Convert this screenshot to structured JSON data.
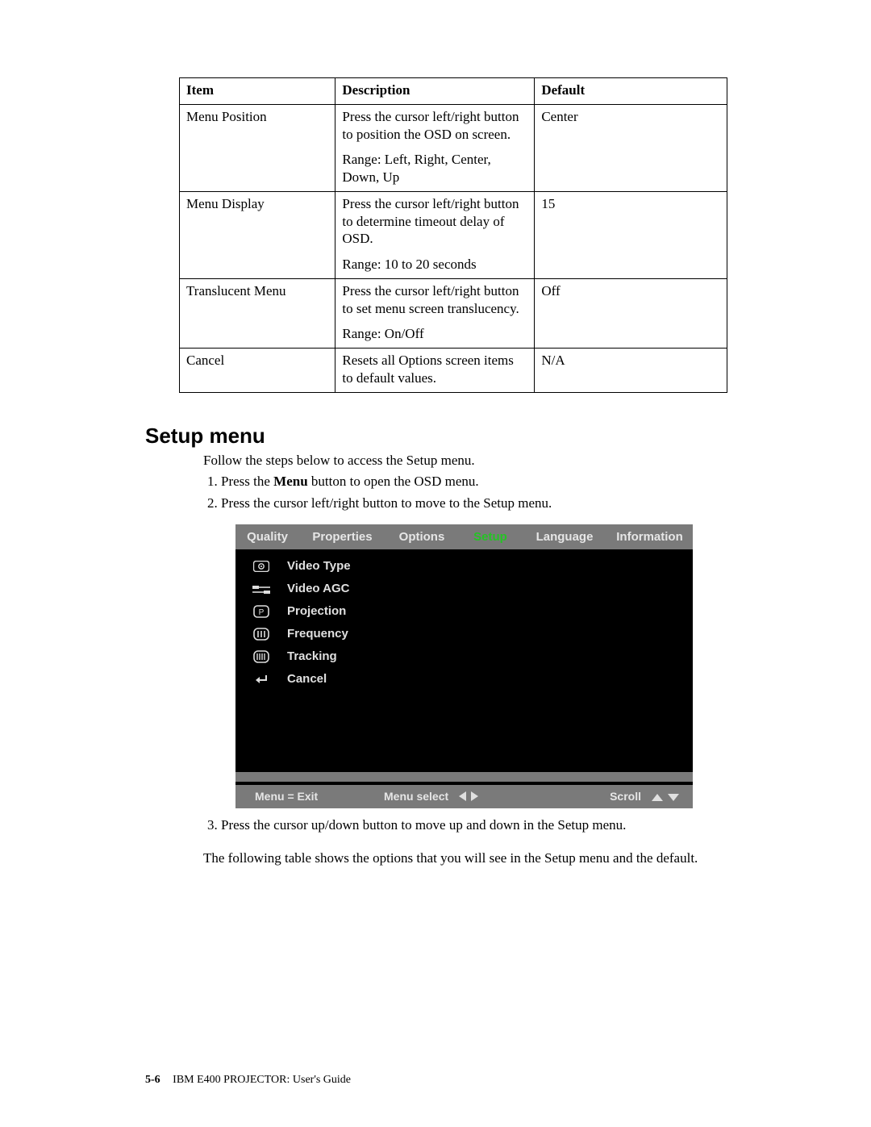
{
  "table": {
    "headers": {
      "c1": "Item",
      "c2": "Description",
      "c3": "Default"
    },
    "rows": [
      {
        "item": "Menu Position",
        "desc1": "Press the cursor left/right button to position the OSD on screen.",
        "desc2": "Range: Left, Right, Center, Down, Up",
        "default": "Center"
      },
      {
        "item": "Menu Display",
        "desc1": "Press the cursor left/right button to determine timeout delay of OSD.",
        "desc2": "Range: 10 to 20 seconds",
        "default": "15"
      },
      {
        "item": "Translucent Menu",
        "desc1": "Press the cursor left/right button to set menu screen translucency.",
        "desc2": "Range: On/Off",
        "default": "Off"
      },
      {
        "item": "Cancel",
        "desc1": "Resets all Options screen items to default values.",
        "desc2": "",
        "default": "N/A"
      }
    ]
  },
  "section_heading": "Setup menu",
  "intro_text": "Follow the steps below to access the Setup menu.",
  "steps": {
    "s1a": "Press the ",
    "s1b": "Menu",
    "s1c": " button to open the OSD menu.",
    "s2": "Press the cursor left/right button to move to the Setup menu."
  },
  "osd": {
    "tabs": [
      "Quality",
      "Properties",
      "Options",
      "Setup",
      "Language",
      "Information"
    ],
    "active_tab": "Setup",
    "items": [
      "Video Type",
      "Video AGC",
      "Projection",
      "Frequency",
      "Tracking",
      "Cancel"
    ],
    "footer": {
      "exit": "Menu = Exit",
      "select": "Menu select",
      "scroll": "Scroll"
    }
  },
  "step3": "Press the cursor up/down button to move up and down in the Setup menu.",
  "closing": "The following table shows the options that you will see in the Setup menu and the default.",
  "footer": {
    "page": "5-6",
    "title": "IBM E400 PROJECTOR: User's Guide"
  }
}
